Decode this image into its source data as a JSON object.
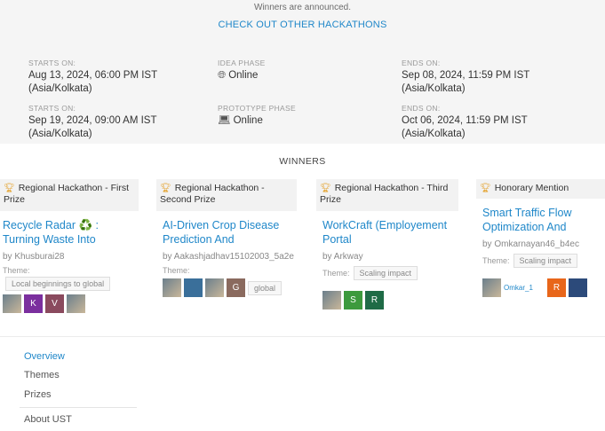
{
  "header": {
    "announcement": "Winners are announced.",
    "other_hackathons_link": "CHECK OUT OTHER HACKATHONS"
  },
  "phases": [
    {
      "starts_label": "STARTS ON:",
      "starts_value": "Aug 13, 2024, 06:00 PM IST (Asia/Kolkata)",
      "phase_label": "IDEA PHASE",
      "phase_value": "Online",
      "phase_icon": "globe-icon",
      "ends_label": "ENDS ON:",
      "ends_value": "Sep 08, 2024, 11:59 PM IST (Asia/Kolkata)"
    },
    {
      "starts_label": "STARTS ON:",
      "starts_value": "Sep 19, 2024, 09:00 AM IST (Asia/Kolkata)",
      "phase_label": "PROTOTYPE PHASE",
      "phase_value": "Online",
      "phase_icon": "laptop-icon",
      "ends_label": "ENDS ON:",
      "ends_value": "Oct 06, 2024, 11:59 PM IST (Asia/Kolkata)"
    }
  ],
  "winners": {
    "title": "WINNERS",
    "cards": [
      {
        "prize": "Regional Hackathon - First Prize",
        "project": "Recycle Radar ♻️ : Turning Waste Into",
        "by": "by Khusburai28",
        "theme_label": "Theme:",
        "theme": "Local beginnings to global",
        "avatars": [
          {
            "type": "photo",
            "letter": ""
          },
          {
            "type": "letter",
            "letter": "K",
            "color": "#7b2f9e"
          },
          {
            "type": "letter",
            "letter": "V",
            "color": "#8a4a5e"
          },
          {
            "type": "photo",
            "letter": ""
          }
        ]
      },
      {
        "prize": "Regional Hackathon - Second Prize",
        "project": "AI-Driven Crop Disease Prediction And",
        "by": "by Aakashjadhav15102003_5a2e",
        "theme_label": "Theme:",
        "theme": "global",
        "avatars": [
          {
            "type": "photo",
            "letter": ""
          },
          {
            "type": "photo",
            "letter": ""
          },
          {
            "type": "photo",
            "letter": ""
          },
          {
            "type": "letter",
            "letter": "G",
            "color": "#8a6a5e"
          }
        ]
      },
      {
        "prize": "Regional Hackathon - Third Prize",
        "project": "WorkCraft (Employement Portal",
        "by": "by Arkway",
        "theme_label": "Theme:",
        "theme": "Scaling impact",
        "avatars": [
          {
            "type": "photo",
            "letter": ""
          },
          {
            "type": "letter",
            "letter": "S",
            "color": "#3d9a3d"
          },
          {
            "type": "letter",
            "letter": "R",
            "color": "#1f6b46"
          }
        ]
      },
      {
        "prize": "Honorary Mention",
        "project": "Smart Traffic Flow Optimization And",
        "by": "by Omkarnayan46_b4ec",
        "theme_label": "Theme:",
        "theme": "Scaling impact",
        "avatars": [
          {
            "type": "photo",
            "letter": ""
          },
          {
            "type": "broken",
            "letter": "Omkar_1"
          },
          {
            "type": "letter",
            "letter": "R",
            "color": "#e8661a"
          },
          {
            "type": "photo",
            "letter": ""
          }
        ]
      }
    ]
  },
  "nav": {
    "overview": "Overview",
    "themes": "Themes",
    "prizes": "Prizes",
    "about": "About UST"
  }
}
